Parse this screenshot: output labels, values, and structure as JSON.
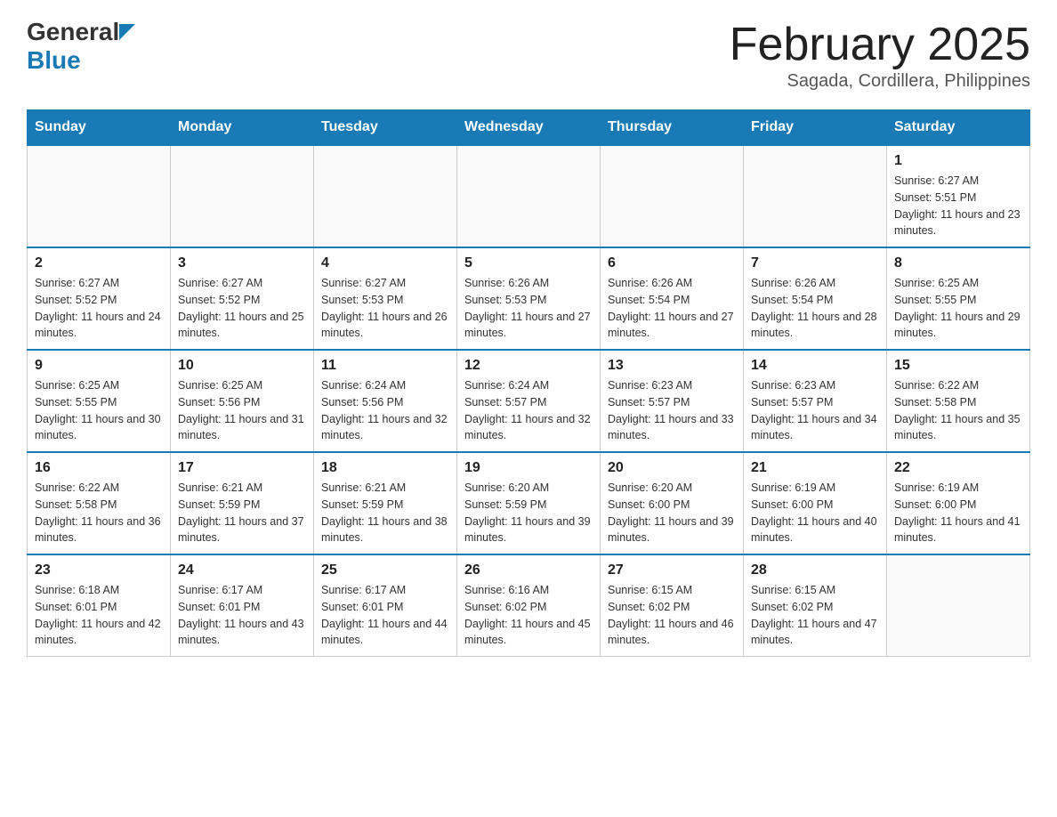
{
  "header": {
    "logo_general": "General",
    "logo_blue": "Blue",
    "title": "February 2025",
    "subtitle": "Sagada, Cordillera, Philippines"
  },
  "days_of_week": [
    "Sunday",
    "Monday",
    "Tuesday",
    "Wednesday",
    "Thursday",
    "Friday",
    "Saturday"
  ],
  "weeks": [
    [
      {
        "day": "",
        "info": ""
      },
      {
        "day": "",
        "info": ""
      },
      {
        "day": "",
        "info": ""
      },
      {
        "day": "",
        "info": ""
      },
      {
        "day": "",
        "info": ""
      },
      {
        "day": "",
        "info": ""
      },
      {
        "day": "1",
        "info": "Sunrise: 6:27 AM\nSunset: 5:51 PM\nDaylight: 11 hours and 23 minutes."
      }
    ],
    [
      {
        "day": "2",
        "info": "Sunrise: 6:27 AM\nSunset: 5:52 PM\nDaylight: 11 hours and 24 minutes."
      },
      {
        "day": "3",
        "info": "Sunrise: 6:27 AM\nSunset: 5:52 PM\nDaylight: 11 hours and 25 minutes."
      },
      {
        "day": "4",
        "info": "Sunrise: 6:27 AM\nSunset: 5:53 PM\nDaylight: 11 hours and 26 minutes."
      },
      {
        "day": "5",
        "info": "Sunrise: 6:26 AM\nSunset: 5:53 PM\nDaylight: 11 hours and 27 minutes."
      },
      {
        "day": "6",
        "info": "Sunrise: 6:26 AM\nSunset: 5:54 PM\nDaylight: 11 hours and 27 minutes."
      },
      {
        "day": "7",
        "info": "Sunrise: 6:26 AM\nSunset: 5:54 PM\nDaylight: 11 hours and 28 minutes."
      },
      {
        "day": "8",
        "info": "Sunrise: 6:25 AM\nSunset: 5:55 PM\nDaylight: 11 hours and 29 minutes."
      }
    ],
    [
      {
        "day": "9",
        "info": "Sunrise: 6:25 AM\nSunset: 5:55 PM\nDaylight: 11 hours and 30 minutes."
      },
      {
        "day": "10",
        "info": "Sunrise: 6:25 AM\nSunset: 5:56 PM\nDaylight: 11 hours and 31 minutes."
      },
      {
        "day": "11",
        "info": "Sunrise: 6:24 AM\nSunset: 5:56 PM\nDaylight: 11 hours and 32 minutes."
      },
      {
        "day": "12",
        "info": "Sunrise: 6:24 AM\nSunset: 5:57 PM\nDaylight: 11 hours and 32 minutes."
      },
      {
        "day": "13",
        "info": "Sunrise: 6:23 AM\nSunset: 5:57 PM\nDaylight: 11 hours and 33 minutes."
      },
      {
        "day": "14",
        "info": "Sunrise: 6:23 AM\nSunset: 5:57 PM\nDaylight: 11 hours and 34 minutes."
      },
      {
        "day": "15",
        "info": "Sunrise: 6:22 AM\nSunset: 5:58 PM\nDaylight: 11 hours and 35 minutes."
      }
    ],
    [
      {
        "day": "16",
        "info": "Sunrise: 6:22 AM\nSunset: 5:58 PM\nDaylight: 11 hours and 36 minutes."
      },
      {
        "day": "17",
        "info": "Sunrise: 6:21 AM\nSunset: 5:59 PM\nDaylight: 11 hours and 37 minutes."
      },
      {
        "day": "18",
        "info": "Sunrise: 6:21 AM\nSunset: 5:59 PM\nDaylight: 11 hours and 38 minutes."
      },
      {
        "day": "19",
        "info": "Sunrise: 6:20 AM\nSunset: 5:59 PM\nDaylight: 11 hours and 39 minutes."
      },
      {
        "day": "20",
        "info": "Sunrise: 6:20 AM\nSunset: 6:00 PM\nDaylight: 11 hours and 39 minutes."
      },
      {
        "day": "21",
        "info": "Sunrise: 6:19 AM\nSunset: 6:00 PM\nDaylight: 11 hours and 40 minutes."
      },
      {
        "day": "22",
        "info": "Sunrise: 6:19 AM\nSunset: 6:00 PM\nDaylight: 11 hours and 41 minutes."
      }
    ],
    [
      {
        "day": "23",
        "info": "Sunrise: 6:18 AM\nSunset: 6:01 PM\nDaylight: 11 hours and 42 minutes."
      },
      {
        "day": "24",
        "info": "Sunrise: 6:17 AM\nSunset: 6:01 PM\nDaylight: 11 hours and 43 minutes."
      },
      {
        "day": "25",
        "info": "Sunrise: 6:17 AM\nSunset: 6:01 PM\nDaylight: 11 hours and 44 minutes."
      },
      {
        "day": "26",
        "info": "Sunrise: 6:16 AM\nSunset: 6:02 PM\nDaylight: 11 hours and 45 minutes."
      },
      {
        "day": "27",
        "info": "Sunrise: 6:15 AM\nSunset: 6:02 PM\nDaylight: 11 hours and 46 minutes."
      },
      {
        "day": "28",
        "info": "Sunrise: 6:15 AM\nSunset: 6:02 PM\nDaylight: 11 hours and 47 minutes."
      },
      {
        "day": "",
        "info": ""
      }
    ]
  ]
}
